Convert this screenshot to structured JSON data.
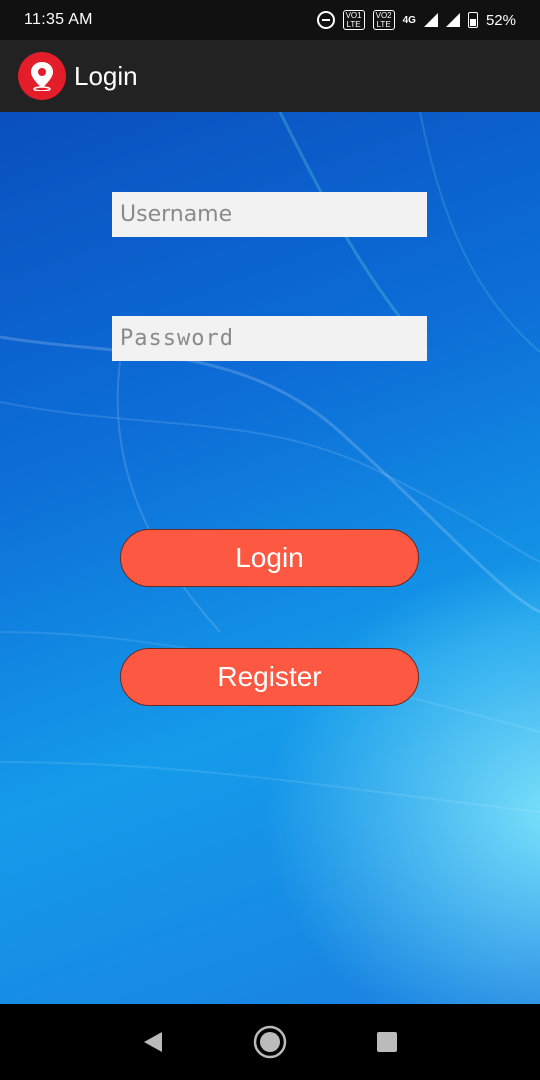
{
  "status_bar": {
    "time": "11:35 AM",
    "sim1": "VO1\nLTE",
    "sim2": "VO2\nLTE",
    "network": "4G",
    "battery_percent": "52%",
    "battery_level": 0.52,
    "icons": [
      "do-not-disturb-icon",
      "volte-1-icon",
      "volte-2-icon",
      "signal-icon",
      "signal-icon",
      "battery-icon"
    ]
  },
  "app_bar": {
    "title": "Login",
    "logo_icon": "location-pin-icon",
    "logo_color": "#e31d2a"
  },
  "form": {
    "username_placeholder": "Username",
    "username_value": "",
    "password_placeholder": "Password",
    "password_value": ""
  },
  "buttons": {
    "login_label": "Login",
    "register_label": "Register",
    "color": "#fd5842"
  },
  "nav_bar": {
    "back_icon": "back-triangle-icon",
    "home_icon": "home-circle-icon",
    "recents_icon": "recents-square-icon"
  }
}
